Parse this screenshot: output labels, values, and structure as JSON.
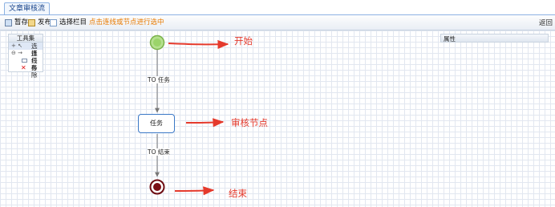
{
  "tabs": [
    {
      "label": "文章审核流"
    }
  ],
  "toolbar": {
    "save_label": "暂存",
    "publish_label": "发布",
    "select_label": "选择栏目",
    "hint": "点击连线或节点进行选中",
    "right_label": "返回"
  },
  "toolbox": {
    "title": "工具集",
    "items": [
      {
        "label": "选择",
        "icon": "pointer-icon"
      },
      {
        "label": "连线",
        "icon": "line-icon"
      },
      {
        "label": "任务",
        "icon": "task-rect-icon"
      },
      {
        "label": "移除",
        "icon": "remove-x-icon"
      }
    ]
  },
  "properties": {
    "title": "属性"
  },
  "flow": {
    "edge_start_task": "TO 任务",
    "task_label": "任务",
    "edge_task_end": "TO 结束"
  },
  "annotations": {
    "start": "开始",
    "review": "审核节点",
    "end": "结束"
  },
  "colors": {
    "accent": "#3a78c6",
    "annotation": "#e53a2c",
    "start_node": "#8ed35c",
    "end_node": "#7a0f16"
  }
}
